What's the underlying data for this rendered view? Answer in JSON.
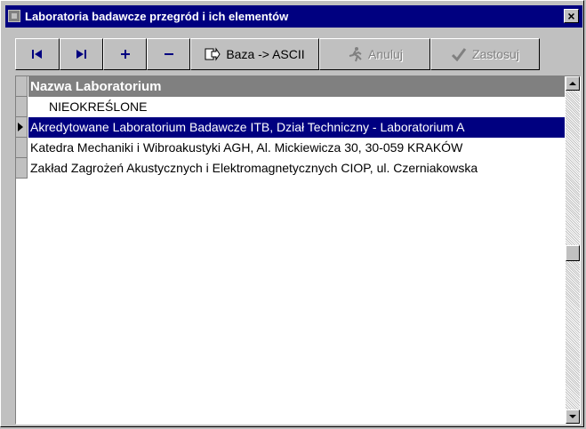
{
  "window": {
    "title": "Laboratoria badawcze przegród i ich elementów",
    "close_label": "×"
  },
  "toolbar": {
    "first_label": "⏮",
    "last_label": "⏭",
    "add_label": "+",
    "remove_label": "−",
    "export_label": "Baza -> ASCII",
    "cancel_label": "Anuluj",
    "apply_label": "Zastosuj"
  },
  "grid": {
    "column_header": "Nazwa Laboratorium",
    "rows": [
      "NIEOKREŚLONE",
      "Akredytowane Laboratorium Badawcze ITB, Dział Techniczny - Laboratorium A",
      "Katedra Mechaniki i Wibroakustyki AGH, Al. Mickiewicza 30, 30-059 KRAKÓW",
      "Zakład Zagrożeń Akustycznych i Elektromagnetycznych CIOP, ul. Czerniakowska"
    ],
    "selected_index": 1
  },
  "colors": {
    "titlebar": "#000080",
    "selection": "#000080",
    "header": "#808080"
  }
}
